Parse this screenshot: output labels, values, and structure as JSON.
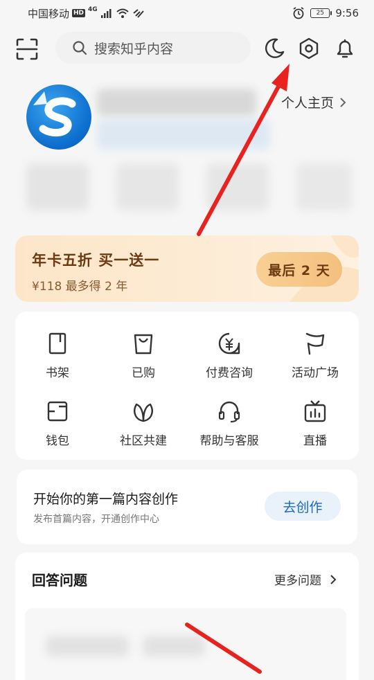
{
  "status_bar": {
    "carrier": "中国移动",
    "hd": "HD",
    "network": "4G",
    "battery": "25",
    "time": "9:56"
  },
  "top_bar": {
    "search_placeholder": "搜索知乎内容"
  },
  "profile": {
    "link_label": "个人主页"
  },
  "promo": {
    "title": "年卡五折  买一送一",
    "subtitle": "¥118 最多得 2 年",
    "button": "最后 2 天"
  },
  "menu": {
    "items": [
      {
        "label": "书架",
        "icon": "bookshelf-icon"
      },
      {
        "label": "已购",
        "icon": "shopping-bag-icon"
      },
      {
        "label": "付费咨询",
        "icon": "paid-consult-icon"
      },
      {
        "label": "活动广场",
        "icon": "flag-icon"
      },
      {
        "label": "钱包",
        "icon": "wallet-icon"
      },
      {
        "label": "社区共建",
        "icon": "leaf-icon"
      },
      {
        "label": "帮助与客服",
        "icon": "headset-icon"
      },
      {
        "label": "直播",
        "icon": "live-tv-icon"
      }
    ]
  },
  "create": {
    "title": "开始你的第一篇内容创作",
    "subtitle": "发布首篇内容，开通创作中心",
    "button": "去创作"
  },
  "answer": {
    "title": "回答问题",
    "more": "更多问题"
  },
  "colors": {
    "accent_blue": "#1766c8",
    "promo_brown": "#6b3a12",
    "arrow_red": "#e8231f"
  }
}
